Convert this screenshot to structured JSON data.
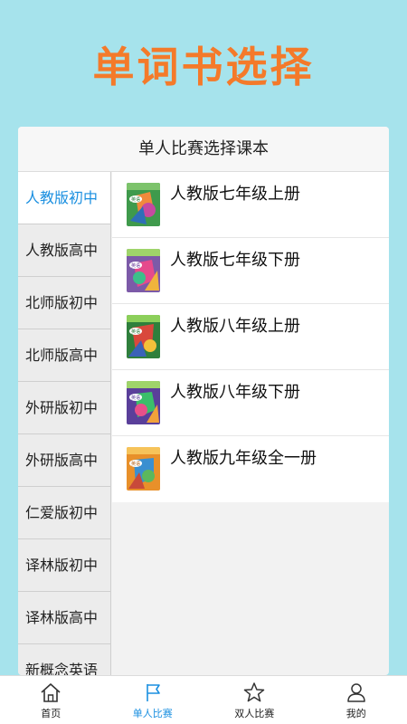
{
  "page_title": "单词书选择",
  "panel": {
    "header": "单人比赛选择课本"
  },
  "colors": {
    "accent_orange": "#f47a2a",
    "accent_blue": "#1a8fe0",
    "background": "#a6e3ec"
  },
  "categories": [
    {
      "label": "人教版初中",
      "active": true
    },
    {
      "label": "人教版高中"
    },
    {
      "label": "北师版初中"
    },
    {
      "label": "北师版高中"
    },
    {
      "label": "外研版初中"
    },
    {
      "label": "外研版高中"
    },
    {
      "label": "仁爱版初中"
    },
    {
      "label": "译林版初中"
    },
    {
      "label": "译林版高中"
    },
    {
      "label": "新概念英语"
    }
  ],
  "books": [
    {
      "title": "人教版七年级上册",
      "cover_text": "英语"
    },
    {
      "title": "人教版七年级下册",
      "cover_text": "英语"
    },
    {
      "title": "人教版八年级上册",
      "cover_text": "英语"
    },
    {
      "title": "人教版八年级下册",
      "cover_text": "英语"
    },
    {
      "title": "人教版九年级全一册",
      "cover_text": "英语"
    }
  ],
  "tabs": [
    {
      "label": "首页",
      "icon": "home-icon"
    },
    {
      "label": "单人比赛",
      "icon": "flag-icon",
      "active": true
    },
    {
      "label": "双人比赛",
      "icon": "star-icon"
    },
    {
      "label": "我的",
      "icon": "user-icon"
    }
  ]
}
